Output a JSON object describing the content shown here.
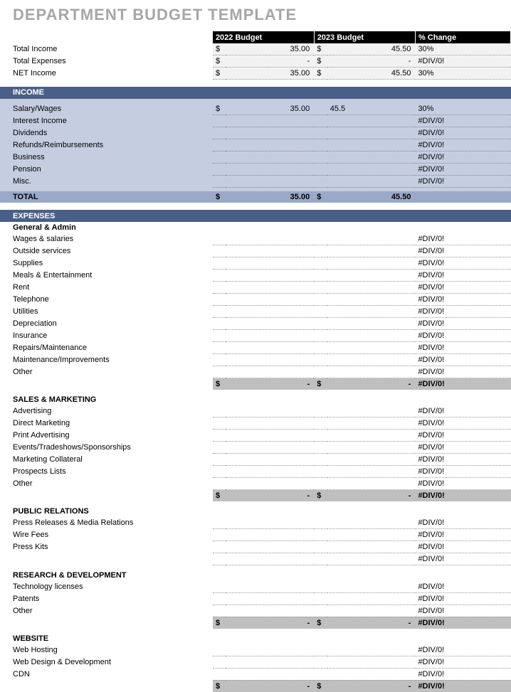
{
  "title": "DEPARTMENT BUDGET TEMPLATE",
  "headers": {
    "budget1": "2022 Budget",
    "budget2": "2023 Budget",
    "pct": "% Change"
  },
  "curr": "$",
  "dash": "-",
  "summary": [
    {
      "label": "Total Income",
      "v1": "35.00",
      "v2": "45.50",
      "pct": "30%"
    },
    {
      "label": "Total Expenses",
      "v1": "-",
      "v2": "-",
      "pct": "#DIV/0!"
    },
    {
      "label": "NET Income",
      "v1": "35.00",
      "v2": "45.50",
      "pct": "30%"
    }
  ],
  "income": {
    "title": "INCOME",
    "rows": [
      {
        "label": "Salary/Wages",
        "curr1": "$",
        "v1": "35.00",
        "v2": "45.5",
        "pct": "30%"
      },
      {
        "label": "Interest Income",
        "pct": "#DIV/0!"
      },
      {
        "label": "Dividends",
        "pct": "#DIV/0!"
      },
      {
        "label": "Refunds/Reimbursements",
        "pct": "#DIV/0!"
      },
      {
        "label": "Business",
        "pct": "#DIV/0!"
      },
      {
        "label": "Pension",
        "pct": "#DIV/0!"
      },
      {
        "label": "Misc.",
        "pct": "#DIV/0!"
      }
    ],
    "total": {
      "label": "TOTAL",
      "v1": "35.00",
      "v2": "45.50"
    }
  },
  "expenses": {
    "title": "EXPENSES",
    "groups": [
      {
        "name": "General & Admin",
        "rows": [
          {
            "label": "Wages & salaries",
            "pct": "#DIV/0!"
          },
          {
            "label": "Outside services",
            "pct": "#DIV/0!"
          },
          {
            "label": "Supplies",
            "pct": "#DIV/0!"
          },
          {
            "label": "Meals & Entertainment",
            "pct": "#DIV/0!"
          },
          {
            "label": "Rent",
            "pct": "#DIV/0!"
          },
          {
            "label": "Telephone",
            "pct": "#DIV/0!"
          },
          {
            "label": "Utilities",
            "pct": "#DIV/0!"
          },
          {
            "label": "Depreciation",
            "pct": "#DIV/0!"
          },
          {
            "label": "Insurance",
            "pct": "#DIV/0!"
          },
          {
            "label": "Repairs/Maintenance",
            "pct": "#DIV/0!"
          },
          {
            "label": "Maintenance/Improvements",
            "pct": "#DIV/0!"
          },
          {
            "label": "Other",
            "pct": "#DIV/0!"
          }
        ],
        "subtotal": {
          "v1": "-",
          "v2": "-",
          "pct": "#DIV/0!"
        }
      },
      {
        "name": "SALES & MARKETING",
        "rows": [
          {
            "label": "Advertising",
            "pct": "#DIV/0!"
          },
          {
            "label": "Direct Marketing",
            "pct": "#DIV/0!"
          },
          {
            "label": "Print Advertising",
            "pct": "#DIV/0!"
          },
          {
            "label": "Events/Tradeshows/Sponsorships",
            "pct": "#DIV/0!"
          },
          {
            "label": "Marketing Collateral",
            "pct": "#DIV/0!"
          },
          {
            "label": "Prospects Lists",
            "pct": "#DIV/0!"
          },
          {
            "label": "Other",
            "pct": "#DIV/0!"
          }
        ],
        "subtotal": {
          "v1": "-",
          "v2": "-",
          "pct": "#DIV/0!"
        }
      },
      {
        "name": "PUBLIC RELATIONS",
        "rows": [
          {
            "label": "Press Releases & Media Relations",
            "pct": "#DIV/0!"
          },
          {
            "label": "Wire Fees",
            "pct": "#DIV/0!"
          },
          {
            "label": "Press Kits",
            "pct": "#DIV/0!"
          },
          {
            "label": "",
            "pct": "#DIV/0!"
          }
        ]
      },
      {
        "name": "RESEARCH & DEVELOPMENT",
        "rows": [
          {
            "label": "Technology licenses",
            "pct": "#DIV/0!"
          },
          {
            "label": "Patents",
            "pct": "#DIV/0!"
          },
          {
            "label": "Other",
            "pct": "#DIV/0!"
          }
        ],
        "subtotal": {
          "v1": "-",
          "v2": "-",
          "pct": "#DIV/0!"
        }
      },
      {
        "name": "WEBSITE",
        "rows": [
          {
            "label": "Web Hosting",
            "pct": "#DIV/0!"
          },
          {
            "label": "Web Design & Development",
            "pct": "#DIV/0!"
          },
          {
            "label": "CDN",
            "pct": "#DIV/0!"
          }
        ],
        "subtotal": {
          "v1": "-",
          "v2": "-",
          "pct": "#DIV/0!"
        }
      }
    ]
  }
}
